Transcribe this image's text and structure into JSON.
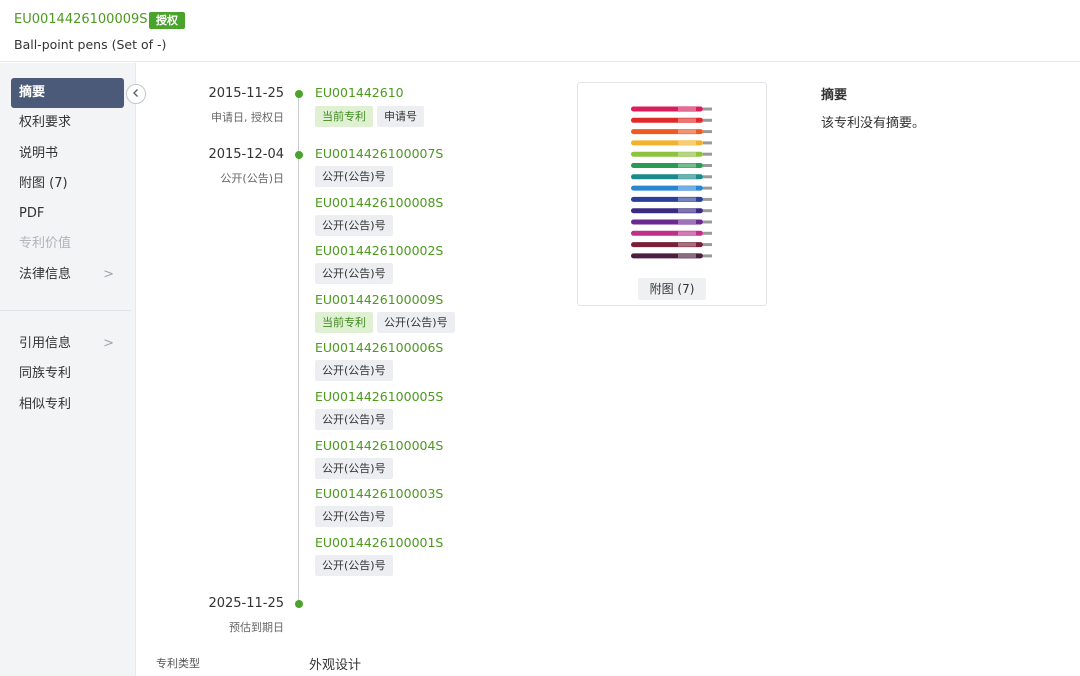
{
  "header": {
    "publication_id": "EU0014426100009S",
    "status_badge": "授权",
    "title": "Ball-point pens (Set of -)"
  },
  "sidebar": {
    "items": [
      {
        "label": "摘要",
        "active": true
      },
      {
        "label": "权利要求"
      },
      {
        "label": "说明书"
      },
      {
        "label": "附图 (7)"
      },
      {
        "label": "PDF"
      },
      {
        "label": "专利价值",
        "disabled": true
      },
      {
        "label": "法律信息",
        "has_arrow": true
      },
      {
        "label": "引用信息",
        "has_arrow": true
      },
      {
        "label": "同族专利"
      },
      {
        "label": "相似专利"
      }
    ],
    "arrow_glyph": ">"
  },
  "timeline": {
    "milestones": [
      {
        "date": "2015-11-25",
        "label": "申请日, 授权日"
      },
      {
        "date": "2015-12-04",
        "label": "公开(公告)日"
      },
      {
        "date": "2025-11-25",
        "label": "预估到期日"
      }
    ],
    "application_entry": {
      "id": "EU001442610",
      "tags": [
        "当前专利",
        "申请号"
      ]
    },
    "publication_entries": [
      {
        "id": "EU0014426100007S",
        "tags": [
          "公开(公告)号"
        ]
      },
      {
        "id": "EU0014426100008S",
        "tags": [
          "公开(公告)号"
        ]
      },
      {
        "id": "EU0014426100002S",
        "tags": [
          "公开(公告)号"
        ]
      },
      {
        "id": "EU0014426100009S",
        "tags": [
          "当前专利",
          "公开(公告)号"
        ]
      },
      {
        "id": "EU0014426100006S",
        "tags": [
          "公开(公告)号"
        ]
      },
      {
        "id": "EU0014426100005S",
        "tags": [
          "公开(公告)号"
        ]
      },
      {
        "id": "EU0014426100004S",
        "tags": [
          "公开(公告)号"
        ]
      },
      {
        "id": "EU0014426100003S",
        "tags": [
          "公开(公告)号"
        ]
      },
      {
        "id": "EU0014426100001S",
        "tags": [
          "公开(公告)号"
        ]
      }
    ]
  },
  "figure": {
    "button_label": "附图 (7)",
    "pen_colors": [
      "#d81e5b",
      "#e02a2a",
      "#ef5a24",
      "#f2b22b",
      "#8fc23f",
      "#2a9a55",
      "#1a8a8a",
      "#2a86d1",
      "#2a3f9c",
      "#3a2a82",
      "#6a2a90",
      "#c0308a",
      "#7a1f3a",
      "#4a1f3f"
    ]
  },
  "abstract": {
    "title": "摘要",
    "text": "该专利没有摘要。"
  },
  "meta": {
    "patent_type_label": "专利类型",
    "patent_type_value": "外观设计"
  },
  "colors": {
    "link_green": "#4c9a1e",
    "badge_green": "#4aa32a",
    "sidebar_active": "#4a5a78"
  },
  "icons": {
    "collapse": "chevron-left-icon"
  }
}
